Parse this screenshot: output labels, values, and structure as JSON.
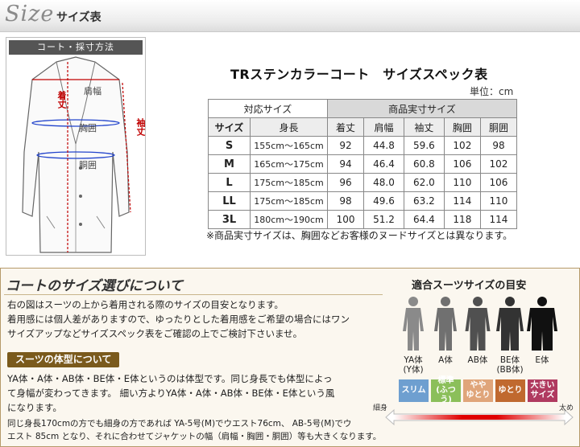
{
  "header": {
    "logo": "Size",
    "title": "サイズ表"
  },
  "diagram": {
    "bar_label": "コート・採寸方法",
    "labels": {
      "shoulder": "肩幅",
      "chest": "胸囲",
      "waist": "胴囲",
      "length": "着丈",
      "sleeve": "袖丈"
    }
  },
  "table": {
    "title": "TRステンカラーコート　サイズスペック表",
    "unit": "単位：cm",
    "group1": "対応サイズ",
    "group2": "商品実寸サイズ",
    "headers": [
      "サイズ",
      "身長",
      "着丈",
      "肩幅",
      "袖丈",
      "胸囲",
      "胴囲"
    ],
    "rows": [
      [
        "S",
        "155cm〜165cm",
        "92",
        "44.8",
        "59.6",
        "102",
        "98"
      ],
      [
        "M",
        "165cm〜175cm",
        "94",
        "46.4",
        "60.8",
        "106",
        "102"
      ],
      [
        "L",
        "175cm〜185cm",
        "96",
        "48.0",
        "62.0",
        "110",
        "106"
      ],
      [
        "LL",
        "175cm〜185cm",
        "98",
        "49.6",
        "63.2",
        "114",
        "110"
      ],
      [
        "3L",
        "180cm〜190cm",
        "100",
        "51.2",
        "64.4",
        "118",
        "114"
      ]
    ],
    "note": "※商品実寸サイズは、胸囲などお客様のヌードサイズとは異なります。"
  },
  "about": {
    "title": "コートのサイズ選びについて",
    "para1_l1": "右の図はスーツの上から着用される際のサイズの目安となります。",
    "para1_l2": "着用感には個人差がありますので、ゆったりとした着用感をご希望の場合にはワン",
    "para1_l3": "サイズアップなどサイズスペック表をご確認の上でご検討下さいませ。",
    "badge": "スーツの体型について",
    "para2_l1": "YA体・A体・AB体・BE体・E体というのは体型です。同じ身長でも体型によっ",
    "para2_l2": "て身幅が変わってきます。 細い方よりYA体・A体・AB体・BE体・E体という風",
    "para2_l3": "になります。",
    "para3_l1": "同じ身長170cmの方でも細身の方であれば YA-5号(M)でウエスト76cm、 AB-5号(M)でウ",
    "para3_l2": "エスト 85cm となり、それに合わせてジャケットの幅（肩幅・胸囲・胴囲）等も大きくなります。"
  },
  "fit": {
    "title": "適合スーツサイズの目安",
    "figures": [
      {
        "label": "YA体",
        "sub": "(Y体)",
        "chip": "スリム",
        "chip_color": "#6e9fd0"
      },
      {
        "label": "A体",
        "sub": "",
        "chip": "標準\n(ふつう)",
        "chip_color": "#8bbf5a"
      },
      {
        "label": "AB体",
        "sub": "",
        "chip": "やや\nゆとり",
        "chip_color": "#e0a57a"
      },
      {
        "label": "BE体",
        "sub": "(BB体)",
        "chip": "ゆとり",
        "chip_color": "#c0692f"
      },
      {
        "label": "E体",
        "sub": "",
        "chip": "大きい\nサイズ",
        "chip_color": "#b03a60"
      }
    ],
    "scale_left": "細身",
    "scale_right": "太め"
  }
}
